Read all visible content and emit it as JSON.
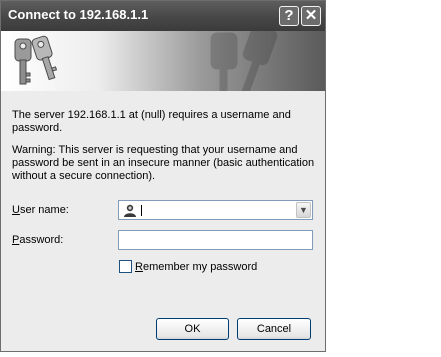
{
  "dialog": {
    "title": "Connect to 192.168.1.1",
    "help_button": "?",
    "close_button": "✕"
  },
  "content": {
    "message": "The server 192.168.1.1 at (null) requires a username and password.",
    "warning": "Warning: This server is requesting that your username and password be sent in an insecure manner (basic authentication without a secure connection).",
    "username_label_accel": "U",
    "username_label_rest": "ser name:",
    "username_value": "",
    "password_label_accel": "P",
    "password_label_rest": "assword:",
    "password_value": "",
    "remember_label_accel": "R",
    "remember_label_rest": "emember my password",
    "remember_checked": false
  },
  "buttons": {
    "ok": "OK",
    "cancel": "Cancel"
  },
  "icons": {
    "banner": "keys-icon",
    "user": "user-icon",
    "dropdown": "chevron-down-icon"
  }
}
